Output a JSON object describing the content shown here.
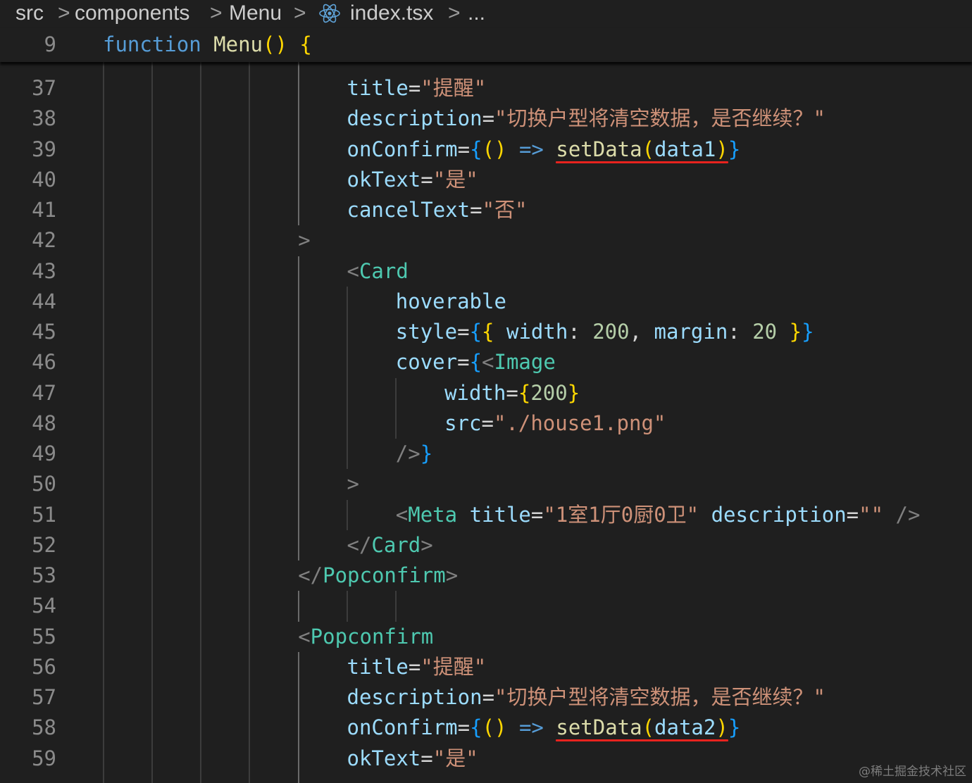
{
  "breadcrumb": {
    "items": [
      "src",
      "components",
      "Menu",
      "index.tsx",
      "..."
    ],
    "separator": ">",
    "file_icon": "react-icon"
  },
  "sticky_scroll": {
    "line_number": "9",
    "tokens": [
      {
        "t": "function",
        "c": "kw"
      },
      {
        "t": " ",
        "c": "op"
      },
      {
        "t": "Menu",
        "c": "fn"
      },
      {
        "t": "()",
        "c": "br1"
      },
      {
        "t": " ",
        "c": "op"
      },
      {
        "t": "{",
        "c": "br1"
      }
    ]
  },
  "editor": {
    "lines": [
      {
        "n": "37",
        "indent": 5,
        "tokens": [
          {
            "t": "title",
            "c": "attr"
          },
          {
            "t": "=",
            "c": "op"
          },
          {
            "t": "\"提醒\"",
            "c": "str"
          }
        ]
      },
      {
        "n": "38",
        "indent": 5,
        "tokens": [
          {
            "t": "description",
            "c": "attr"
          },
          {
            "t": "=",
            "c": "op"
          },
          {
            "t": "\"切换户型将清空数据，是否继续？\"",
            "c": "str"
          }
        ]
      },
      {
        "n": "39",
        "indent": 5,
        "tokens": [
          {
            "t": "onConfirm",
            "c": "attr"
          },
          {
            "t": "=",
            "c": "op"
          },
          {
            "t": "{",
            "c": "br3"
          },
          {
            "t": "()",
            "c": "br1"
          },
          {
            "t": " ",
            "c": "op"
          },
          {
            "t": "=>",
            "c": "kw"
          },
          {
            "t": " ",
            "c": "op"
          },
          {
            "t": "setData",
            "c": "fn"
          },
          {
            "t": "(",
            "c": "br1"
          },
          {
            "t": "data1",
            "c": "var"
          },
          {
            "t": ")",
            "c": "br1"
          },
          {
            "t": "}",
            "c": "br3"
          }
        ]
      },
      {
        "n": "40",
        "indent": 5,
        "tokens": [
          {
            "t": "okText",
            "c": "attr"
          },
          {
            "t": "=",
            "c": "op"
          },
          {
            "t": "\"是\"",
            "c": "str"
          }
        ]
      },
      {
        "n": "41",
        "indent": 5,
        "tokens": [
          {
            "t": "cancelText",
            "c": "attr"
          },
          {
            "t": "=",
            "c": "op"
          },
          {
            "t": "\"否\"",
            "c": "str"
          }
        ]
      },
      {
        "n": "42",
        "indent": 4,
        "tokens": [
          {
            "t": ">",
            "c": "punc"
          }
        ]
      },
      {
        "n": "43",
        "indent": 5,
        "tokens": [
          {
            "t": "<",
            "c": "punc"
          },
          {
            "t": "Card",
            "c": "tag"
          }
        ]
      },
      {
        "n": "44",
        "indent": 6,
        "tokens": [
          {
            "t": "hoverable",
            "c": "attr"
          }
        ]
      },
      {
        "n": "45",
        "indent": 6,
        "tokens": [
          {
            "t": "style",
            "c": "attr"
          },
          {
            "t": "=",
            "c": "op"
          },
          {
            "t": "{",
            "c": "br3"
          },
          {
            "t": "{",
            "c": "br1"
          },
          {
            "t": " ",
            "c": "op"
          },
          {
            "t": "width",
            "c": "attr"
          },
          {
            "t": ": ",
            "c": "op"
          },
          {
            "t": "200",
            "c": "num"
          },
          {
            "t": ", ",
            "c": "op"
          },
          {
            "t": "margin",
            "c": "attr"
          },
          {
            "t": ": ",
            "c": "op"
          },
          {
            "t": "20",
            "c": "num"
          },
          {
            "t": " ",
            "c": "op"
          },
          {
            "t": "}",
            "c": "br1"
          },
          {
            "t": "}",
            "c": "br3"
          }
        ]
      },
      {
        "n": "46",
        "indent": 6,
        "tokens": [
          {
            "t": "cover",
            "c": "attr"
          },
          {
            "t": "=",
            "c": "op"
          },
          {
            "t": "{",
            "c": "br3"
          },
          {
            "t": "<",
            "c": "punc"
          },
          {
            "t": "Image",
            "c": "tag"
          }
        ]
      },
      {
        "n": "47",
        "indent": 7,
        "tokens": [
          {
            "t": "width",
            "c": "attr"
          },
          {
            "t": "=",
            "c": "op"
          },
          {
            "t": "{",
            "c": "br1"
          },
          {
            "t": "200",
            "c": "num"
          },
          {
            "t": "}",
            "c": "br1"
          }
        ]
      },
      {
        "n": "48",
        "indent": 7,
        "tokens": [
          {
            "t": "src",
            "c": "attr"
          },
          {
            "t": "=",
            "c": "op"
          },
          {
            "t": "\"./house1.png\"",
            "c": "str"
          }
        ]
      },
      {
        "n": "49",
        "indent": 6,
        "tokens": [
          {
            "t": "/>",
            "c": "punc"
          },
          {
            "t": "}",
            "c": "br3"
          }
        ]
      },
      {
        "n": "50",
        "indent": 5,
        "tokens": [
          {
            "t": ">",
            "c": "punc"
          }
        ]
      },
      {
        "n": "51",
        "indent": 6,
        "tokens": [
          {
            "t": "<",
            "c": "punc"
          },
          {
            "t": "Meta",
            "c": "tag"
          },
          {
            "t": " ",
            "c": "op"
          },
          {
            "t": "title",
            "c": "attr"
          },
          {
            "t": "=",
            "c": "op"
          },
          {
            "t": "\"1室1厅0厨0卫\"",
            "c": "str"
          },
          {
            "t": " ",
            "c": "op"
          },
          {
            "t": "description",
            "c": "attr"
          },
          {
            "t": "=",
            "c": "op"
          },
          {
            "t": "\"\"",
            "c": "str"
          },
          {
            "t": " ",
            "c": "op"
          },
          {
            "t": "/>",
            "c": "punc"
          }
        ]
      },
      {
        "n": "52",
        "indent": 5,
        "tokens": [
          {
            "t": "</",
            "c": "punc"
          },
          {
            "t": "Card",
            "c": "tag"
          },
          {
            "t": ">",
            "c": "punc"
          }
        ]
      },
      {
        "n": "53",
        "indent": 4,
        "tokens": [
          {
            "t": "</",
            "c": "punc"
          },
          {
            "t": "Popconfirm",
            "c": "tag"
          },
          {
            "t": ">",
            "c": "punc"
          }
        ]
      },
      {
        "n": "54",
        "indent": 4,
        "tokens": []
      },
      {
        "n": "55",
        "indent": 4,
        "tokens": [
          {
            "t": "<",
            "c": "punc"
          },
          {
            "t": "Popconfirm",
            "c": "tag"
          }
        ]
      },
      {
        "n": "56",
        "indent": 5,
        "tokens": [
          {
            "t": "title",
            "c": "attr"
          },
          {
            "t": "=",
            "c": "op"
          },
          {
            "t": "\"提醒\"",
            "c": "str"
          }
        ]
      },
      {
        "n": "57",
        "indent": 5,
        "tokens": [
          {
            "t": "description",
            "c": "attr"
          },
          {
            "t": "=",
            "c": "op"
          },
          {
            "t": "\"切换户型将清空数据，是否继续？\"",
            "c": "str"
          }
        ]
      },
      {
        "n": "58",
        "indent": 5,
        "tokens": [
          {
            "t": "onConfirm",
            "c": "attr"
          },
          {
            "t": "=",
            "c": "op"
          },
          {
            "t": "{",
            "c": "br3"
          },
          {
            "t": "()",
            "c": "br1"
          },
          {
            "t": " ",
            "c": "op"
          },
          {
            "t": "=>",
            "c": "kw"
          },
          {
            "t": " ",
            "c": "op"
          },
          {
            "t": "setData",
            "c": "fn"
          },
          {
            "t": "(",
            "c": "br1"
          },
          {
            "t": "data2",
            "c": "var"
          },
          {
            "t": ")",
            "c": "br1"
          },
          {
            "t": "}",
            "c": "br3"
          }
        ]
      },
      {
        "n": "59",
        "indent": 5,
        "tokens": [
          {
            "t": "okText",
            "c": "attr"
          },
          {
            "t": "=",
            "c": "op"
          },
          {
            "t": "\"是\"",
            "c": "str"
          }
        ]
      }
    ],
    "highlights": [
      {
        "line": "39",
        "text": "setData(data1)",
        "color": "#e8231e"
      },
      {
        "line": "58",
        "text": "setData(data2)",
        "color": "#e8231e"
      }
    ]
  },
  "watermark": "@稀土掘金技术社区",
  "colors": {
    "background": "#1f1f1f",
    "keyword": "#569cd6",
    "function": "#dcdcaa",
    "attribute": "#9cdcfe",
    "string": "#ce9178",
    "tag": "#4ec9b0",
    "number": "#b5cea8",
    "highlight_underline": "#e8231e"
  }
}
